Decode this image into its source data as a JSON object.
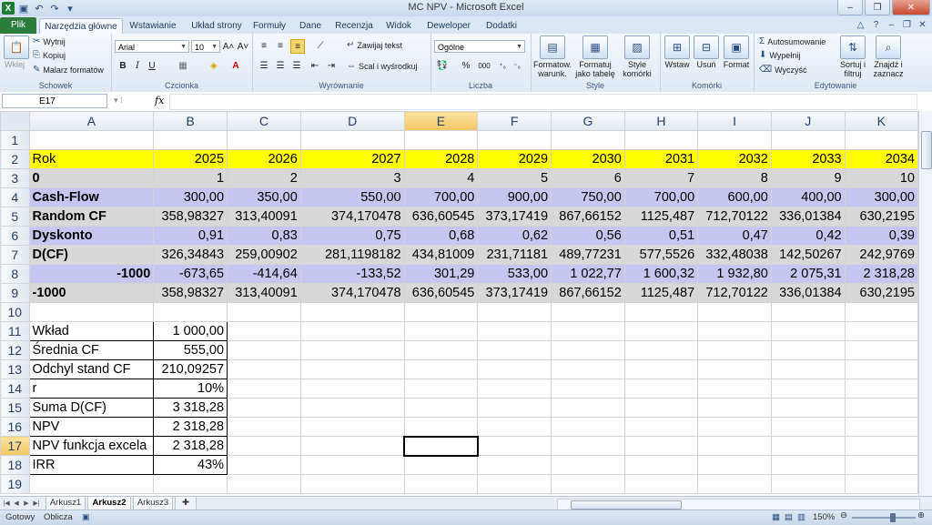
{
  "window": {
    "title": "MC NPV  -  Microsoft Excel",
    "controls": [
      "–",
      "❐",
      "✕"
    ]
  },
  "ribbon": {
    "tabs": [
      "Plik",
      "Narzędzia główne",
      "Wstawianie",
      "Układ strony",
      "Formuły",
      "Dane",
      "Recenzja",
      "Widok",
      "Deweloper",
      "Dodatki"
    ],
    "active_tab": "Narzędzia główne",
    "clipboard": {
      "paste": "Wklej",
      "cut": "Wytnij",
      "copy": "Kopiuj",
      "format_painter": "Malarz formatów",
      "label": "Schowek"
    },
    "font": {
      "name": "Arial",
      "size": "10",
      "label": "Czcionka",
      "bold": "B",
      "italic": "I",
      "underline": "U"
    },
    "alignment": {
      "wrap": "Zawijaj tekst",
      "merge": "Scal i wyśrodkuj",
      "label": "Wyrównanie"
    },
    "number": {
      "format": "Ogólne",
      "label": "Liczba",
      "percent": "%",
      "thousands": "000"
    },
    "styles": {
      "conditional": "Formatow. warunk.",
      "table": "Formatuj jako tabelę",
      "cell": "Style komórki",
      "label": "Style"
    },
    "cells": {
      "insert": "Wstaw",
      "delete": "Usuń",
      "format": "Format",
      "label": "Komórki"
    },
    "editing": {
      "autosum": "Autosumowanie",
      "fill": "Wypełnij",
      "clear": "Wyczyść",
      "sort": "Sortuj i filtruj",
      "find": "Znajdź i zaznacz",
      "label": "Edytowanie"
    }
  },
  "formula_bar": {
    "name_box": "E17",
    "fx": "fx",
    "formula": ""
  },
  "grid": {
    "columns": [
      "A",
      "B",
      "C",
      "D",
      "E",
      "F",
      "G",
      "H",
      "I",
      "J",
      "K"
    ],
    "selected_column": "E",
    "selected_row": "17",
    "rows": [
      {
        "n": "1",
        "cells": [
          "",
          "",
          "",
          "",
          "",
          "",
          "",
          "",
          "",
          "",
          ""
        ]
      },
      {
        "n": "2",
        "cells": [
          "Rok",
          "2025",
          "2026",
          "2027",
          "2028",
          "2029",
          "2030",
          "2031",
          "2032",
          "2033",
          "2034"
        ]
      },
      {
        "n": "3",
        "cells": [
          "0",
          "1",
          "2",
          "3",
          "4",
          "5",
          "6",
          "7",
          "8",
          "9",
          "10"
        ]
      },
      {
        "n": "4",
        "cells": [
          "Cash-Flow",
          "300,00",
          "350,00",
          "550,00",
          "700,00",
          "900,00",
          "750,00",
          "700,00",
          "600,00",
          "400,00",
          "300,00"
        ]
      },
      {
        "n": "5",
        "cells": [
          "Random CF",
          "358,98327",
          "313,40091",
          "374,170478",
          "636,60545",
          "373,17419",
          "867,66152",
          "1125,487",
          "712,70122",
          "336,01384",
          "630,2195"
        ]
      },
      {
        "n": "6",
        "cells": [
          "Dyskonto",
          "0,91",
          "0,83",
          "0,75",
          "0,68",
          "0,62",
          "0,56",
          "0,51",
          "0,47",
          "0,42",
          "0,39"
        ]
      },
      {
        "n": "7",
        "cells": [
          "D(CF)",
          "326,34843",
          "259,00902",
          "281,1198182",
          "434,81009",
          "231,71181",
          "489,77231",
          "577,5526",
          "332,48038",
          "142,50267",
          "242,9769"
        ]
      },
      {
        "n": "8",
        "cells": [
          "-1000",
          "-673,65",
          "-414,64",
          "-133,52",
          "301,29",
          "533,00",
          "1 022,77",
          "1 600,32",
          "1 932,80",
          "2 075,31",
          "2 318,28"
        ]
      },
      {
        "n": "9",
        "cells": [
          "-1000",
          "358,98327",
          "313,40091",
          "374,170478",
          "636,60545",
          "373,17419",
          "867,66152",
          "1125,487",
          "712,70122",
          "336,01384",
          "630,2195"
        ]
      },
      {
        "n": "10",
        "cells": [
          "",
          "",
          "",
          "",
          "",
          "",
          "",
          "",
          "",
          "",
          ""
        ]
      },
      {
        "n": "11",
        "cells": [
          "Wkład",
          "1 000,00",
          "",
          "",
          "",
          "",
          "",
          "",
          "",
          "",
          ""
        ]
      },
      {
        "n": "12",
        "cells": [
          "Średnia CF",
          "555,00",
          "",
          "",
          "",
          "",
          "",
          "",
          "",
          "",
          ""
        ]
      },
      {
        "n": "13",
        "cells": [
          "Odchyl stand CF",
          "210,09257",
          "",
          "",
          "",
          "",
          "",
          "",
          "",
          "",
          ""
        ]
      },
      {
        "n": "14",
        "cells": [
          "r",
          "10%",
          "",
          "",
          "",
          "",
          "",
          "",
          "",
          "",
          ""
        ]
      },
      {
        "n": "15",
        "cells": [
          "Suma D(CF)",
          "3 318,28",
          "",
          "",
          "",
          "",
          "",
          "",
          "",
          "",
          ""
        ]
      },
      {
        "n": "16",
        "cells": [
          "NPV",
          "2 318,28",
          "",
          "",
          "",
          "",
          "",
          "",
          "",
          "",
          ""
        ]
      },
      {
        "n": "17",
        "cells": [
          "NPV funkcja excela",
          "2 318,28",
          "",
          "",
          "",
          "",
          "",
          "",
          "",
          "",
          ""
        ]
      },
      {
        "n": "18",
        "cells": [
          "IRR",
          "43%",
          "",
          "",
          "",
          "",
          "",
          "",
          "",
          "",
          ""
        ]
      },
      {
        "n": "19",
        "cells": [
          "",
          "",
          "",
          "",
          "",
          "",
          "",
          "",
          "",
          "",
          ""
        ]
      }
    ]
  },
  "sheets": {
    "tabs": [
      "Arkusz1",
      "Arkusz2",
      "Arkusz3"
    ],
    "active": "Arkusz2"
  },
  "status": {
    "ready": "Gotowy",
    "calculate": "Oblicza",
    "zoom": "150%"
  }
}
